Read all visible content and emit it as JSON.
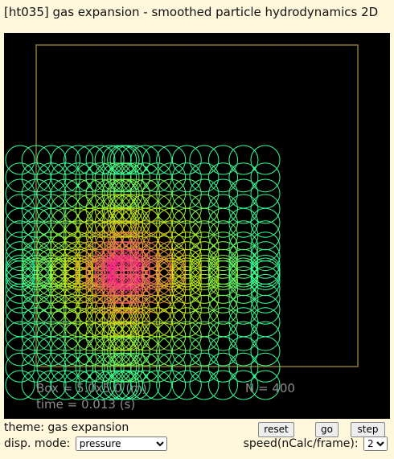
{
  "title": "[ht035] gas expansion - smoothed particle hydrodynamics 2D",
  "canvas": {
    "box_label": "Box = 5.0x5.0 (m)",
    "time_label": "time = 0.013 (s)",
    "n_label": "N = 400",
    "colors": {
      "background": "#000000",
      "box_outline": "#8a7a2e",
      "overlay_text": "#8c8c8c",
      "low_pressure": "#33ff99",
      "mid_pressure": "#ccee00",
      "high_pressure": "#ff1493"
    }
  },
  "controls": {
    "theme_text": "theme: gas expansion",
    "disp_mode_label": "disp. mode:",
    "disp_mode_value": "pressure",
    "reset_label": "reset",
    "go_label": "go",
    "step_label": "step",
    "speed_label": "speed(nCalc/frame):",
    "speed_value": "2"
  }
}
